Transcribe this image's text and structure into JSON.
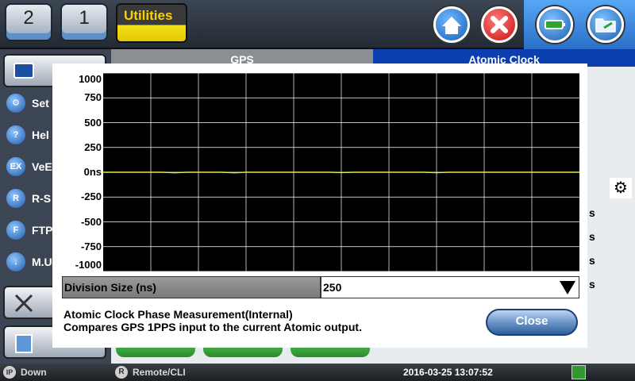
{
  "topbar": {
    "port2_label": "2",
    "port1_label": "1",
    "utilities_label": "Utilities"
  },
  "sidebar": {
    "items": [
      {
        "label": "Set",
        "icon": "wrench-icon",
        "glyph": "⚙"
      },
      {
        "label": "Hel",
        "icon": "help-icon",
        "glyph": "?"
      },
      {
        "label": "VeE",
        "icon": "ex-icon",
        "glyph": "EX"
      },
      {
        "label": "R-S",
        "icon": "r-icon",
        "glyph": "R"
      },
      {
        "label": "FTP",
        "icon": "f-icon",
        "glyph": "F"
      },
      {
        "label": "M.U",
        "icon": "download-icon",
        "glyph": "↓"
      }
    ]
  },
  "tabs": {
    "gps": "GPS",
    "atomic": "Atomic Clock"
  },
  "background_units": [
    "s",
    "s",
    "s",
    "s"
  ],
  "dialog": {
    "y_ticks": [
      "1000",
      "750",
      "500",
      "250",
      "0ns",
      "-250",
      "-500",
      "-750",
      "-1000"
    ],
    "division_label": "Division Size (ns)",
    "division_value": "250",
    "description_line1": "Atomic Clock Phase Measurement(Internal)",
    "description_line2": "Compares GPS 1PPS input to the current Atomic output.",
    "close_label": "Close"
  },
  "statusbar": {
    "ip_icon_text": "IP",
    "ip_status": "Down",
    "remote_icon_text": "R",
    "remote_label": "Remote/CLI",
    "datetime": "2016-03-25  13:07:52"
  },
  "colors": {
    "plot_bg": "#000000",
    "grid": "#ffffff",
    "trace": "#e8e84a",
    "accent_tab": "#0b3fb0"
  },
  "chart_data": {
    "type": "line",
    "ylim": [
      -1000,
      1000
    ],
    "y_tick_values": [
      1000,
      750,
      500,
      250,
      0,
      -250,
      -500,
      -750,
      -1000
    ],
    "grid": true,
    "series": [
      {
        "values": [
          0,
          0,
          0,
          0,
          0,
          0,
          -5,
          0,
          0,
          0,
          0,
          -5,
          0,
          0,
          0,
          0,
          0,
          0,
          0,
          0,
          -3,
          0,
          0,
          0,
          0,
          0,
          0,
          0,
          -4,
          0,
          0,
          0,
          0,
          0,
          0,
          0,
          0,
          0,
          0,
          0,
          0
        ]
      }
    ]
  }
}
